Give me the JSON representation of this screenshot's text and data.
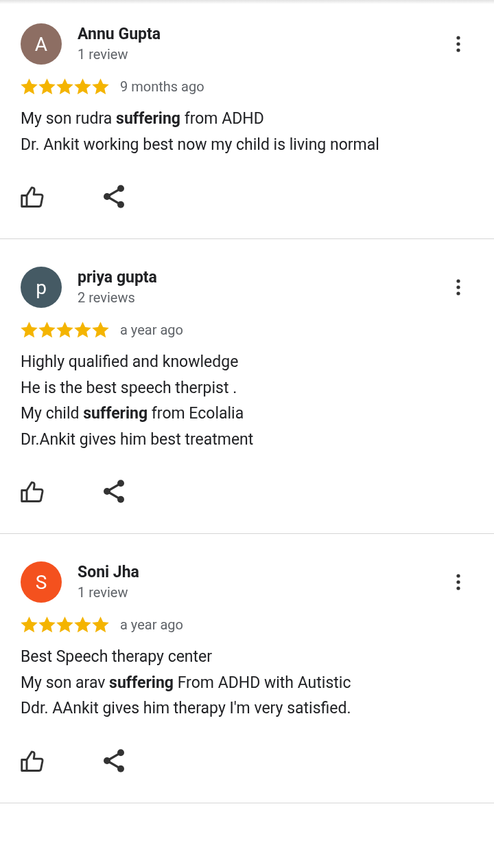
{
  "reviews": [
    {
      "avatar_letter": "A",
      "color": "#8d6e63",
      "name": "Annu Gupta",
      "count": "1 review",
      "stars": 5,
      "time": "9 months ago",
      "text": "My son rudra **suffering** from ADHD\nDr. Ankit working best now my child is living normal"
    },
    {
      "avatar_letter": "p",
      "color": "#455a64",
      "name": "priya gupta",
      "count": "2 reviews",
      "stars": 5,
      "time": "a year ago",
      "text": "Highly qualified and knowledge\nHe is the best speech therpist .\nMy child **suffering** from Ecolalia\nDr.Ankit gives him best treatment"
    },
    {
      "avatar_letter": "S",
      "color": "#f4511e",
      "name": "Soni Jha",
      "count": "1 review",
      "stars": 5,
      "time": "a year ago",
      "text": "Best Speech therapy center\nMy son arav **suffering** From ADHD with Autistic\nDdr. AAnkit gives him therapy I'm very satisfied."
    }
  ]
}
